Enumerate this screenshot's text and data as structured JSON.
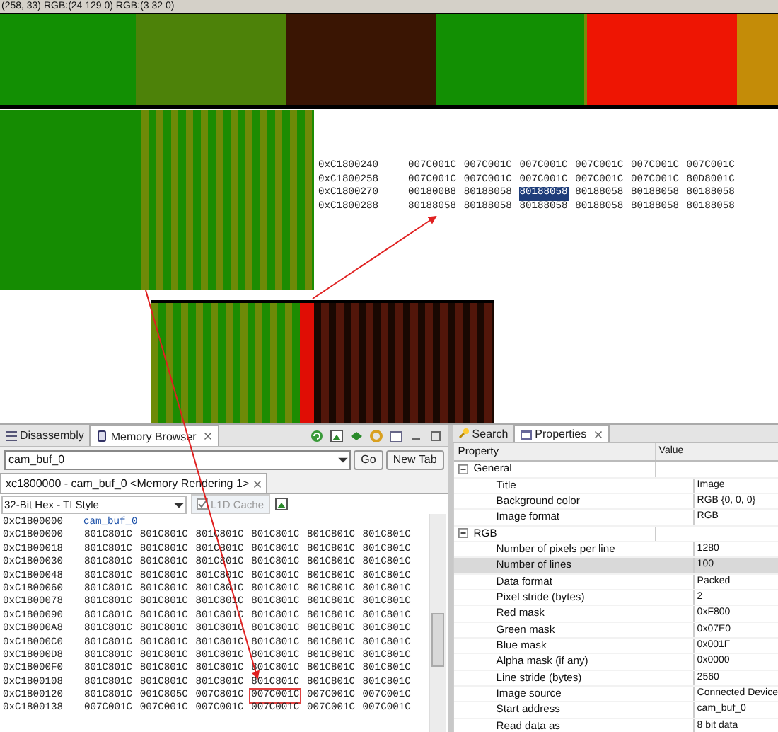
{
  "status_text": "(258, 33) RGB:(24 129 0) RGB:(3 32 0)",
  "memory_snippet": [
    {
      "address": "0xC1800240",
      "cells": [
        {
          "value": "007C001C",
          "selected": false
        },
        {
          "value": "007C001C",
          "selected": false
        },
        {
          "value": "007C001C",
          "selected": false
        },
        {
          "value": "007C001C",
          "selected": false
        },
        {
          "value": "007C001C",
          "selected": false
        },
        {
          "value": "007C001C",
          "selected": false
        }
      ]
    },
    {
      "address": "0xC1800258",
      "cells": [
        {
          "value": "007C001C",
          "selected": false
        },
        {
          "value": "007C001C",
          "selected": false
        },
        {
          "value": "007C001C",
          "selected": false
        },
        {
          "value": "007C001C",
          "selected": false
        },
        {
          "value": "007C001C",
          "selected": false
        },
        {
          "value": "80D8001C",
          "selected": false
        }
      ]
    },
    {
      "address": "0xC1800270",
      "cells": [
        {
          "value": "001800B8",
          "selected": false
        },
        {
          "value": "80188058",
          "selected": false
        },
        {
          "value": "80188058",
          "selected": true
        },
        {
          "value": "80188058",
          "selected": false
        },
        {
          "value": "80188058",
          "selected": false
        },
        {
          "value": "80188058",
          "selected": false
        }
      ]
    },
    {
      "address": "0xC1800288",
      "cells": [
        {
          "value": "80188058",
          "selected": false
        },
        {
          "value": "80188058",
          "selected": false
        },
        {
          "value": "80188058",
          "selected": false
        },
        {
          "value": "80188058",
          "selected": false
        },
        {
          "value": "80188058",
          "selected": false
        },
        {
          "value": "80188058",
          "selected": false
        }
      ]
    }
  ],
  "memory_browser": {
    "tabs": [
      {
        "label": "Disassembly",
        "selected": false
      },
      {
        "label": "Memory Browser",
        "selected": true
      }
    ],
    "address_field": {
      "value": "cam_buf_0"
    },
    "buttons": [
      "Go",
      "New Tab"
    ],
    "rendering_tab": "xc1800000 - cam_buf_0 <Memory Rendering 1>",
    "format": "32-Bit Hex - TI Style",
    "cache_checkbox": {
      "label": "L1D Cache",
      "checked": true,
      "disabled": true
    },
    "label_row": {
      "address": "0xC1800000",
      "label": "cam_buf_0"
    },
    "rows": [
      {
        "address": "0xC1800000",
        "cells": [
          {
            "value": "801C801C",
            "boxed": false
          },
          {
            "value": "801C801C",
            "boxed": false
          },
          {
            "value": "801C801C",
            "boxed": false
          },
          {
            "value": "801C801C",
            "boxed": false
          },
          {
            "value": "801C801C",
            "boxed": false
          },
          {
            "value": "801C801C",
            "boxed": false
          }
        ]
      },
      {
        "address": "0xC1800018",
        "cells": [
          {
            "value": "801C801C",
            "boxed": false
          },
          {
            "value": "801C801C",
            "boxed": false
          },
          {
            "value": "801C801C",
            "boxed": false
          },
          {
            "value": "801C801C",
            "boxed": false
          },
          {
            "value": "801C801C",
            "boxed": false
          },
          {
            "value": "801C801C",
            "boxed": false
          }
        ]
      },
      {
        "address": "0xC1800030",
        "cells": [
          {
            "value": "801C801C",
            "boxed": false
          },
          {
            "value": "801C801C",
            "boxed": false
          },
          {
            "value": "801C801C",
            "boxed": false
          },
          {
            "value": "801C801C",
            "boxed": false
          },
          {
            "value": "801C801C",
            "boxed": false
          },
          {
            "value": "801C801C",
            "boxed": false
          }
        ]
      },
      {
        "address": "0xC1800048",
        "cells": [
          {
            "value": "801C801C",
            "boxed": false
          },
          {
            "value": "801C801C",
            "boxed": false
          },
          {
            "value": "801C801C",
            "boxed": false
          },
          {
            "value": "801C801C",
            "boxed": false
          },
          {
            "value": "801C801C",
            "boxed": false
          },
          {
            "value": "801C801C",
            "boxed": false
          }
        ]
      },
      {
        "address": "0xC1800060",
        "cells": [
          {
            "value": "801C801C",
            "boxed": false
          },
          {
            "value": "801C801C",
            "boxed": false
          },
          {
            "value": "801C801C",
            "boxed": false
          },
          {
            "value": "801C801C",
            "boxed": false
          },
          {
            "value": "801C801C",
            "boxed": false
          },
          {
            "value": "801C801C",
            "boxed": false
          }
        ]
      },
      {
        "address": "0xC1800078",
        "cells": [
          {
            "value": "801C801C",
            "boxed": false
          },
          {
            "value": "801C801C",
            "boxed": false
          },
          {
            "value": "801C801C",
            "boxed": false
          },
          {
            "value": "801C801C",
            "boxed": false
          },
          {
            "value": "801C801C",
            "boxed": false
          },
          {
            "value": "801C801C",
            "boxed": false
          }
        ]
      },
      {
        "address": "0xC1800090",
        "cells": [
          {
            "value": "801C801C",
            "boxed": false
          },
          {
            "value": "801C801C",
            "boxed": false
          },
          {
            "value": "801C801C",
            "boxed": false
          },
          {
            "value": "801C801C",
            "boxed": false
          },
          {
            "value": "801C801C",
            "boxed": false
          },
          {
            "value": "801C801C",
            "boxed": false
          }
        ]
      },
      {
        "address": "0xC18000A8",
        "cells": [
          {
            "value": "801C801C",
            "boxed": false
          },
          {
            "value": "801C801C",
            "boxed": false
          },
          {
            "value": "801C801C",
            "boxed": false
          },
          {
            "value": "801C801C",
            "boxed": false
          },
          {
            "value": "801C801C",
            "boxed": false
          },
          {
            "value": "801C801C",
            "boxed": false
          }
        ]
      },
      {
        "address": "0xC18000C0",
        "cells": [
          {
            "value": "801C801C",
            "boxed": false
          },
          {
            "value": "801C801C",
            "boxed": false
          },
          {
            "value": "801C801C",
            "boxed": false
          },
          {
            "value": "801C801C",
            "boxed": false
          },
          {
            "value": "801C801C",
            "boxed": false
          },
          {
            "value": "801C801C",
            "boxed": false
          }
        ]
      },
      {
        "address": "0xC18000D8",
        "cells": [
          {
            "value": "801C801C",
            "boxed": false
          },
          {
            "value": "801C801C",
            "boxed": false
          },
          {
            "value": "801C801C",
            "boxed": false
          },
          {
            "value": "801C801C",
            "boxed": false
          },
          {
            "value": "801C801C",
            "boxed": false
          },
          {
            "value": "801C801C",
            "boxed": false
          }
        ]
      },
      {
        "address": "0xC18000F0",
        "cells": [
          {
            "value": "801C801C",
            "boxed": false
          },
          {
            "value": "801C801C",
            "boxed": false
          },
          {
            "value": "801C801C",
            "boxed": false
          },
          {
            "value": "801C801C",
            "boxed": false
          },
          {
            "value": "801C801C",
            "boxed": false
          },
          {
            "value": "801C801C",
            "boxed": false
          }
        ]
      },
      {
        "address": "0xC1800108",
        "cells": [
          {
            "value": "801C801C",
            "boxed": false
          },
          {
            "value": "801C801C",
            "boxed": false
          },
          {
            "value": "801C801C",
            "boxed": false
          },
          {
            "value": "801C801C",
            "boxed": false
          },
          {
            "value": "801C801C",
            "boxed": false
          },
          {
            "value": "801C801C",
            "boxed": false
          }
        ]
      },
      {
        "address": "0xC1800120",
        "cells": [
          {
            "value": "801C801C",
            "boxed": false
          },
          {
            "value": "001C805C",
            "boxed": false
          },
          {
            "value": "007C801C",
            "boxed": false
          },
          {
            "value": "007C001C",
            "boxed": true
          },
          {
            "value": "007C001C",
            "boxed": false
          },
          {
            "value": "007C001C",
            "boxed": false
          }
        ]
      },
      {
        "address": "0xC1800138",
        "cells": [
          {
            "value": "007C001C",
            "boxed": false
          },
          {
            "value": "007C001C",
            "boxed": false
          },
          {
            "value": "007C001C",
            "boxed": false
          },
          {
            "value": "007C001C",
            "boxed": false
          },
          {
            "value": "007C001C",
            "boxed": false
          },
          {
            "value": "007C001C",
            "boxed": false
          }
        ]
      }
    ]
  },
  "properties": {
    "tabs": [
      {
        "label": "Search",
        "selected": false
      },
      {
        "label": "Properties",
        "selected": true
      }
    ],
    "columns": [
      "Property",
      "Value"
    ],
    "groups": [
      {
        "name": "General",
        "expanded": true,
        "children": [
          {
            "property": "Title",
            "value": "Image",
            "selected": false
          },
          {
            "property": "Background color",
            "value": "RGB {0, 0, 0}",
            "selected": false
          },
          {
            "property": "Image format",
            "value": "RGB",
            "selected": false
          }
        ]
      },
      {
        "name": "RGB",
        "expanded": true,
        "children": [
          {
            "property": "Number of pixels per line",
            "value": "1280",
            "selected": false
          },
          {
            "property": "Number of lines",
            "value": "100",
            "selected": true
          },
          {
            "property": "Data format",
            "value": "Packed",
            "selected": false
          },
          {
            "property": "Pixel stride (bytes)",
            "value": "2",
            "selected": false
          },
          {
            "property": "Red mask",
            "value": "0xF800",
            "selected": false
          },
          {
            "property": "Green mask",
            "value": "0x07E0",
            "selected": false
          },
          {
            "property": "Blue mask",
            "value": "0x001F",
            "selected": false
          },
          {
            "property": "Alpha mask (if any)",
            "value": "0x0000",
            "selected": false
          },
          {
            "property": "Line stride (bytes)",
            "value": "2560",
            "selected": false
          },
          {
            "property": "Image source",
            "value": "Connected Device",
            "selected": false
          },
          {
            "property": "Start address",
            "value": "cam_buf_0",
            "selected": false
          },
          {
            "property": "Read data as",
            "value": "8 bit data",
            "selected": false
          }
        ]
      }
    ]
  }
}
